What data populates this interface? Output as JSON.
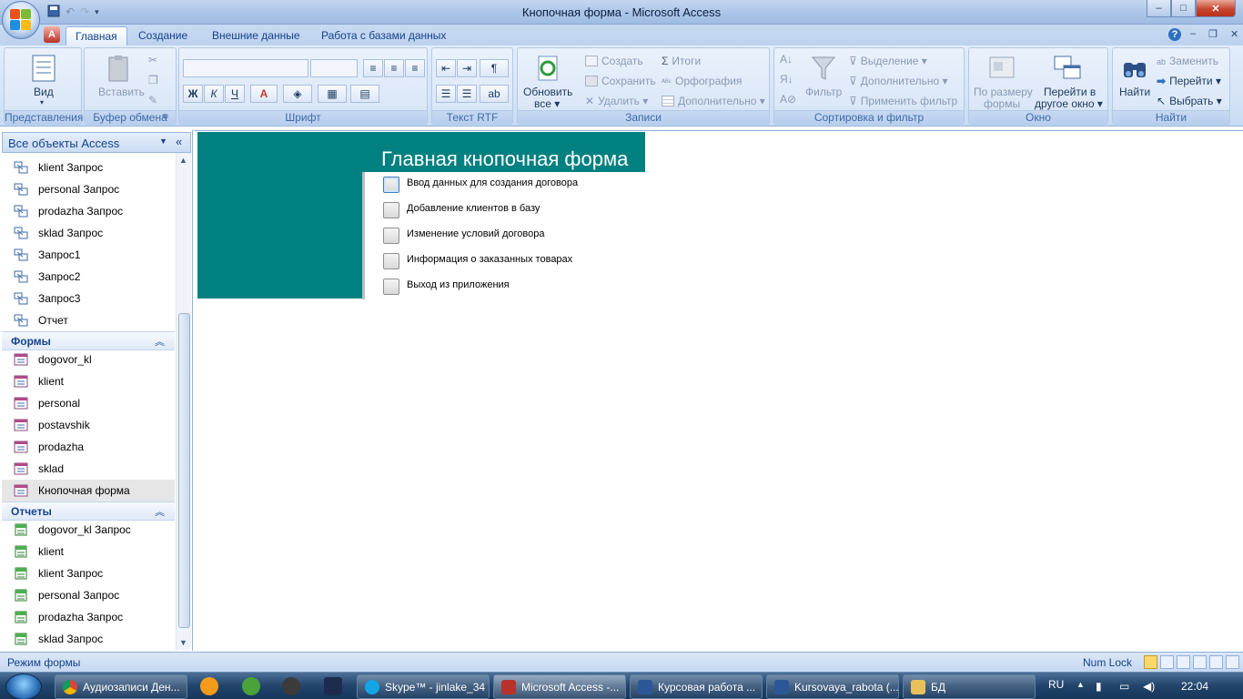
{
  "window": {
    "title": "Кнопочная форма - Microsoft Access",
    "qat_icons": [
      "save-icon",
      "undo-icon",
      "redo-icon",
      "customize-qat-icon"
    ],
    "controls": {
      "minimize": "–",
      "maximize": "□",
      "close": "✕"
    }
  },
  "ribbon": {
    "tabs": [
      {
        "label": "Главная",
        "active": true
      },
      {
        "label": "Создание",
        "active": false
      },
      {
        "label": "Внешние данные",
        "active": false
      },
      {
        "label": "Работа с базами данных",
        "active": false
      }
    ],
    "help": "?",
    "doc_controls": {
      "minimize": "–",
      "restore": "❐",
      "close": "✕"
    },
    "groups": {
      "views": {
        "label": "Представления",
        "view_button": "Вид"
      },
      "clipboard": {
        "label": "Буфер обмена",
        "paste": "Вставить"
      },
      "font": {
        "label": "Шрифт",
        "bold": "Ж",
        "italic": "К",
        "underline": "Ч"
      },
      "rtf": {
        "label": "Текст RTF"
      },
      "records": {
        "label": "Записи",
        "refresh_line1": "Обновить",
        "refresh_line2": "все",
        "create": "Создать",
        "save": "Сохранить",
        "delete": "Удалить",
        "totals": "Итоги",
        "spelling": "Орфография",
        "more": "Дополнительно"
      },
      "sort_filter": {
        "label": "Сортировка и фильтр",
        "filter": "Фильтр",
        "selection": "Выделение",
        "advanced": "Дополнительно",
        "apply_filter": "Применить фильтр"
      },
      "window": {
        "label": "Окно",
        "fit_line1": "По размеру",
        "fit_line2": "формы",
        "switch_line1": "Перейти в",
        "switch_line2": "другое окно"
      },
      "find": {
        "label": "Найти",
        "find": "Найти",
        "replace": "Заменить",
        "goto": "Перейти",
        "select": "Выбрать"
      }
    }
  },
  "nav": {
    "header": "Все объекты Access",
    "items_top": [
      "klient Запрос",
      "personal Запрос",
      "prodazha Запрос",
      "sklad Запрос",
      "Запрос1",
      "Запрос2",
      "Запрос3",
      "Отчет"
    ],
    "forms_label": "Формы",
    "forms": [
      "dogovor_kl",
      "klient",
      "personal",
      "postavshik",
      "prodazha",
      "sklad",
      "Кнопочная форма"
    ],
    "selected_form": "Кнопочная форма",
    "reports_label": "Отчеты",
    "reports": [
      "dogovor_kl Запрос",
      "klient",
      "klient Запрос",
      "personal Запрос",
      "prodazha Запрос",
      "sklad Запрос"
    ]
  },
  "form": {
    "title": "Главная кнопочная форма",
    "buttons": [
      "Ввод данных для создания договора",
      "Добавление клиентов в базу",
      "Изменение условий договора",
      "Информация о заказанных товарах",
      "Выход из приложения"
    ]
  },
  "status": {
    "mode": "Режим формы",
    "numlock": "Num Lock"
  },
  "taskbar": {
    "items": [
      {
        "label": "Аудиозаписи Ден...",
        "icon": "chrome-icon"
      },
      {
        "label": "Skype™ - jinlake_34",
        "icon": "skype-icon"
      },
      {
        "label": "Microsoft Access -...",
        "icon": "access-icon"
      },
      {
        "label": "Курсовая работа ...",
        "icon": "word-icon"
      },
      {
        "label": "Kursovaya_rabota (...",
        "icon": "word-icon"
      },
      {
        "label": "БД",
        "icon": "folder-icon"
      }
    ],
    "pinned": [
      "avast-icon",
      "utorrent-icon",
      "app-icon",
      "photoshop-icon"
    ],
    "lang": "RU",
    "time": "22:04"
  },
  "colors": {
    "form_header": "#008080",
    "ribbon_bg": "#d4e3f6",
    "tab_text": "#15428b"
  }
}
